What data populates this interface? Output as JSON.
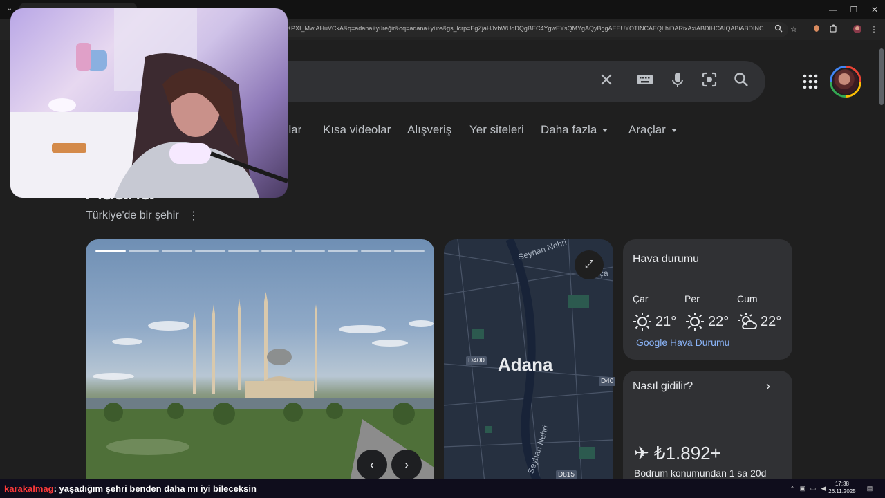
{
  "browser": {
    "url": "nKPXI_MwiAHuVCkA&q=adana+yüreğir&oq=adana+yüre&gs_lcrp=EgZjaHJvbWUqDQgBEC4YgwEYsQMYgAQyBggAEEUYOTINCAEQLhiDARixAxiABDIHCAIQABiABDINC...",
    "window_controls": {
      "minimize": "—",
      "restore": "❐",
      "close": "✕"
    }
  },
  "search": {
    "query_fragment": "r"
  },
  "nav": {
    "tabs": [
      {
        "label": "olar"
      },
      {
        "label": "Kısa videolar"
      },
      {
        "label": "Alışveriş"
      },
      {
        "label": "Yer siteleri"
      },
      {
        "label": "Daha fazla"
      },
      {
        "label": "Araçlar"
      }
    ]
  },
  "entity": {
    "title_fragment": "Adana",
    "subtitle": "Türkiye'de bir şehir",
    "more_icon": "⋮"
  },
  "carousel": {
    "segments": 10,
    "active_segment": 1,
    "prev": "‹",
    "next": "›"
  },
  "map": {
    "city": "Adana",
    "labels": {
      "river_top": "Seyhan Nehri",
      "district": "Sarıça",
      "river_bottom": "Seyhan Nehri"
    },
    "shields": {
      "d400_left": "D400",
      "d400_right": "D40",
      "d815": "D815"
    },
    "expand": "⤢"
  },
  "weather": {
    "title": "Hava durumu",
    "days": [
      {
        "name": "Çar",
        "temp": "21°",
        "icon": "sunny-icon"
      },
      {
        "name": "Per",
        "temp": "22°",
        "icon": "sunny-icon"
      },
      {
        "name": "Cum",
        "temp": "22°",
        "icon": "partly-cloudy-icon"
      }
    ],
    "link": "Google Hava Durumu"
  },
  "directions": {
    "title": "Nasıl gidilir?",
    "chevron": "›",
    "price": "✈ ₺1.892+",
    "from": "Bodrum konumundan 1 sa 20d"
  },
  "stream_chat": {
    "user": "karakalmag",
    "message": ": yaşadığım şehri benden daha mı iyi bileceksin"
  },
  "tray": {
    "time": "17:38",
    "date": "26.11.2025"
  }
}
